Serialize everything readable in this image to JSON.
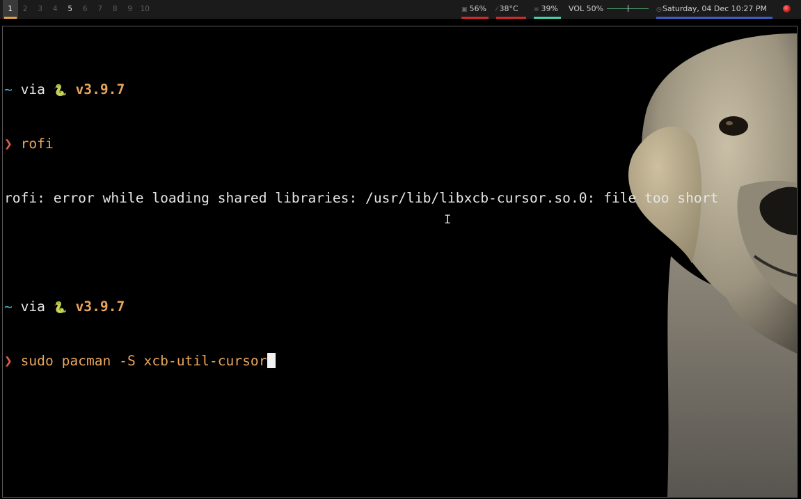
{
  "bar": {
    "workspaces": [
      {
        "label": "1",
        "state": "active"
      },
      {
        "label": "2",
        "state": "empty"
      },
      {
        "label": "3",
        "state": "empty"
      },
      {
        "label": "4",
        "state": "empty"
      },
      {
        "label": "5",
        "state": "occupied"
      },
      {
        "label": "6",
        "state": "empty"
      },
      {
        "label": "7",
        "state": "empty"
      },
      {
        "label": "8",
        "state": "empty"
      },
      {
        "label": "9",
        "state": "empty"
      },
      {
        "label": "10",
        "state": "empty"
      }
    ],
    "cpu": {
      "icon": "cpu-icon",
      "value": "56%",
      "color": "#d22b2b"
    },
    "temp": {
      "icon": "thermometer-icon",
      "value": "38°C",
      "color": "#d22b2b"
    },
    "memory": {
      "icon": "memory-icon",
      "value": "39%",
      "color": "#47d1b1"
    },
    "volume": {
      "label": "VOL 50%",
      "level": 0.5,
      "color": "#48a06a"
    },
    "clock": {
      "icon": "clock-icon",
      "value": "Saturday, 04 Dec 10:27 PM",
      "color": "#3b5fc7"
    },
    "power": {
      "icon": "power-icon",
      "color": "#d91a1a"
    }
  },
  "terminal": {
    "lines": [
      {
        "prefix": "~",
        "via": " via ",
        "icon": "🐍",
        "version": "v3.9.7"
      },
      {
        "arrow": "❯",
        "command": "rofi"
      },
      {
        "output": "rofi: error while loading shared libraries: /usr/lib/libxcb-cursor.so.0: file too short"
      },
      {
        "prefix": "~",
        "via": " via ",
        "icon": "🐍",
        "version": "v3.9.7"
      },
      {
        "arrow": "❯",
        "command": "sudo pacman -S xcb-util-cursor"
      }
    ]
  },
  "wallpaper": {
    "subject": "labrador-dog-image"
  }
}
